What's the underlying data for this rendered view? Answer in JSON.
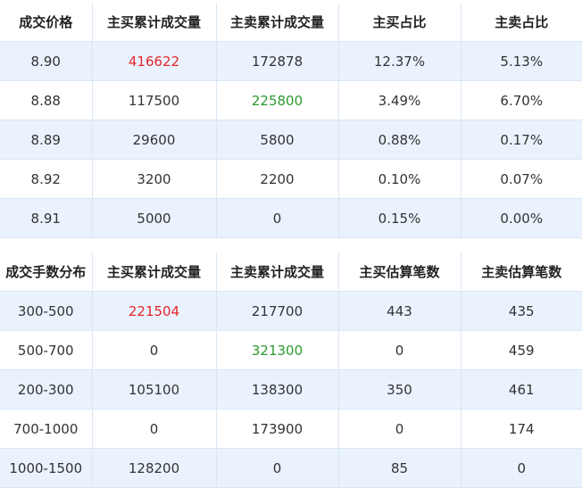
{
  "price_table": {
    "headers": [
      "成交价格",
      "主买累计成交量",
      "主卖累计成交量",
      "主买占比",
      "主卖占比"
    ],
    "rows": [
      [
        "8.90",
        "416622",
        "172878",
        "12.37%",
        "5.13%"
      ],
      [
        "8.88",
        "117500",
        "225800",
        "3.49%",
        "6.70%"
      ],
      [
        "8.89",
        "29600",
        "5800",
        "0.88%",
        "0.17%"
      ],
      [
        "8.92",
        "3200",
        "2200",
        "0.10%",
        "0.07%"
      ],
      [
        "8.91",
        "5000",
        "0",
        "0.15%",
        "0.00%"
      ]
    ]
  },
  "lot_table": {
    "headers": [
      "成交手数分布",
      "主买累计成交量",
      "主卖累计成交量",
      "主买估算笔数",
      "主卖估算笔数"
    ],
    "rows": [
      [
        "300-500",
        "221504",
        "217700",
        "443",
        "435"
      ],
      [
        "500-700",
        "0",
        "321300",
        "0",
        "459"
      ],
      [
        "200-300",
        "105100",
        "138300",
        "350",
        "461"
      ],
      [
        "700-1000",
        "0",
        "173900",
        "0",
        "174"
      ],
      [
        "1000-1500",
        "128200",
        "0",
        "85",
        "0"
      ]
    ]
  },
  "colors": {
    "max_buy_highlight": "#e4262c",
    "max_sell_highlight": "#2c9a2c",
    "row_stripe": "#eaf2fd",
    "grid_line": "#d9e6f4"
  }
}
